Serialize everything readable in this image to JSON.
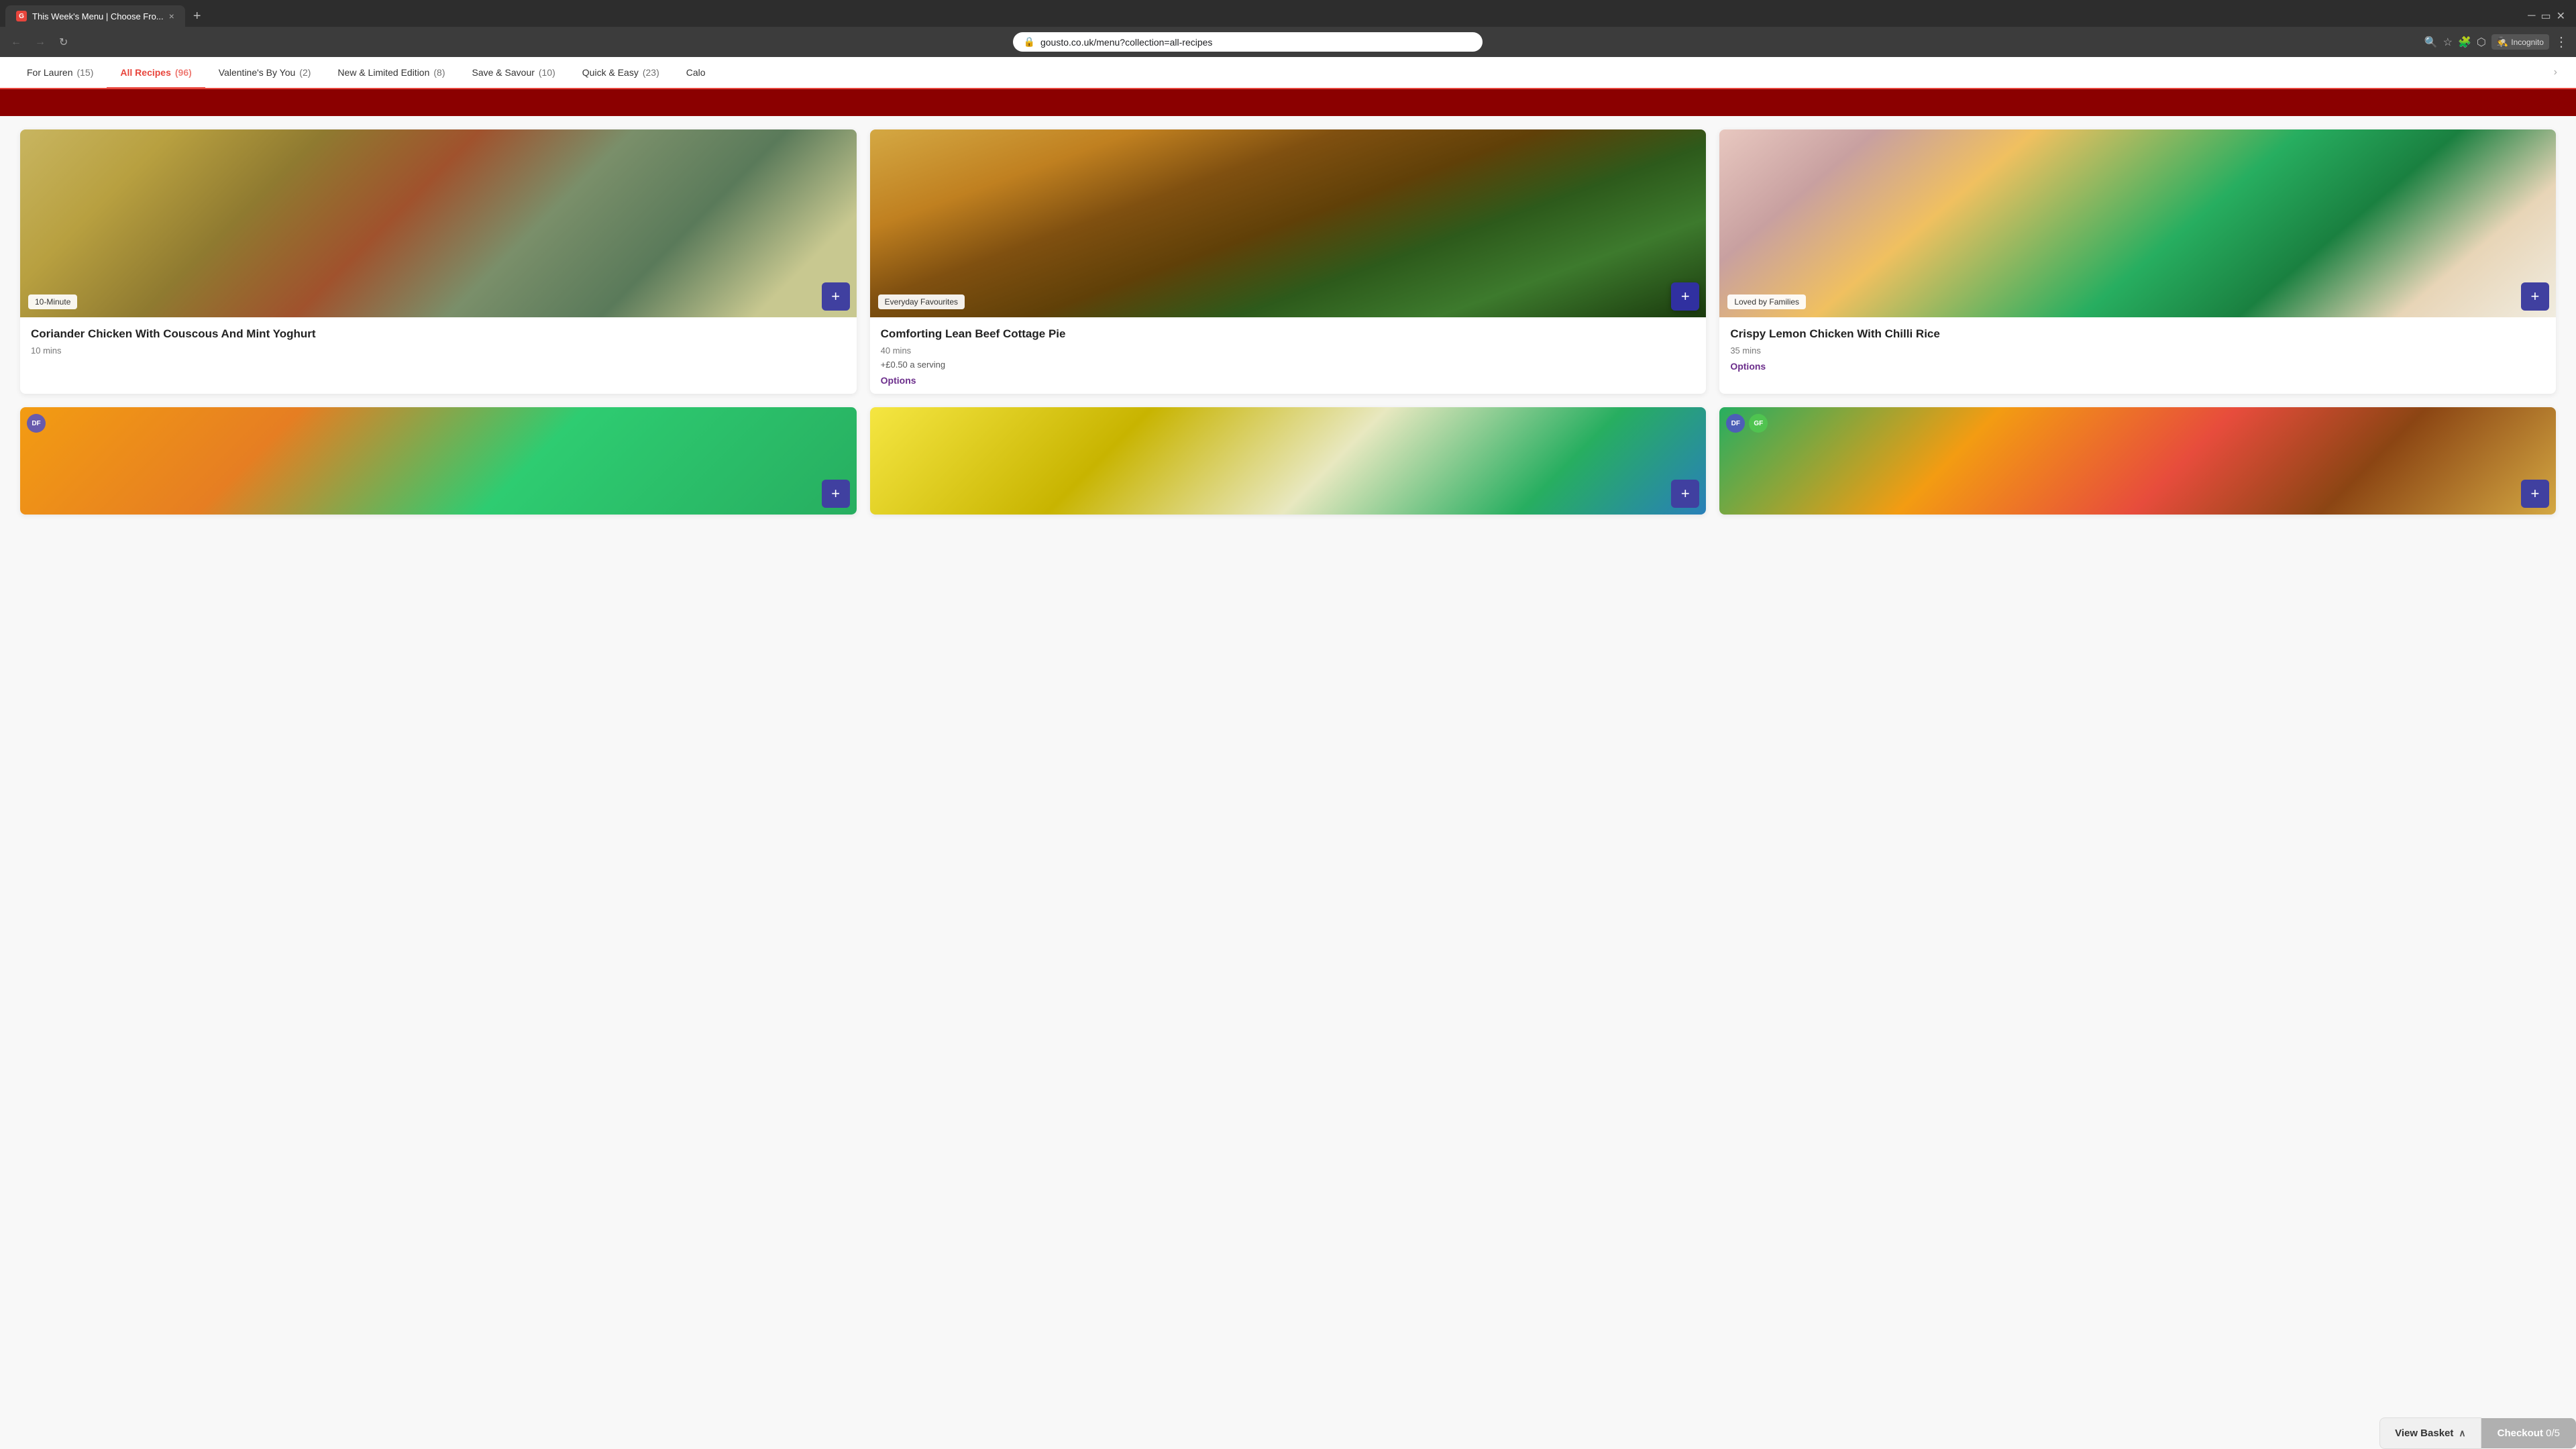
{
  "browser": {
    "tab_favicon": "G",
    "tab_title": "This Week's Menu | Choose Fro...",
    "tab_close": "×",
    "tab_new": "+",
    "url": "gousto.co.uk/menu?collection=all-recipes",
    "incognito_label": "Incognito",
    "nav_back": "←",
    "nav_forward": "→",
    "nav_refresh": "↻",
    "menu_dots": "⋮"
  },
  "nav": {
    "tabs": [
      {
        "id": "for-lauren",
        "label": "For Lauren",
        "count": "(15)"
      },
      {
        "id": "all-recipes",
        "label": "All Recipes",
        "count": "(96)",
        "active": true
      },
      {
        "id": "valentines",
        "label": "Valentine's By You",
        "count": "(2)"
      },
      {
        "id": "new-limited",
        "label": "New & Limited Edition",
        "count": "(8)"
      },
      {
        "id": "save-savour",
        "label": "Save & Savour",
        "count": "(10)"
      },
      {
        "id": "quick-easy",
        "label": "Quick & Easy",
        "count": "(23)"
      },
      {
        "id": "calo",
        "label": "Calo",
        "count": ""
      }
    ],
    "more_arrow": "›"
  },
  "recipes": [
    {
      "id": "card-1",
      "tag": "10-Minute",
      "title": "Coriander Chicken With Couscous And Mint Yoghurt",
      "time": "10 mins",
      "price": null,
      "options": null,
      "add_btn": "+",
      "badges": [],
      "img_class": "recipe-img-1"
    },
    {
      "id": "card-2",
      "tag": "Everyday Favourites",
      "title": "Comforting Lean Beef Cottage Pie",
      "time": "40 mins",
      "price": "+£0.50 a serving",
      "options": "Options",
      "add_btn": "+",
      "badges": [],
      "img_class": "recipe-img-2"
    },
    {
      "id": "card-3",
      "tag": "Loved by Families",
      "title": "Crispy Lemon Chicken With Chilli Rice",
      "time": "35 mins",
      "price": null,
      "options": "Options",
      "add_btn": "+",
      "badges": [],
      "img_class": "recipe-img-3"
    },
    {
      "id": "card-4",
      "tag": null,
      "title": "",
      "time": "",
      "price": null,
      "options": null,
      "add_btn": "+",
      "badges": [
        "DF"
      ],
      "img_class": "recipe-img-4"
    },
    {
      "id": "card-5",
      "tag": null,
      "title": "",
      "time": "",
      "price": null,
      "options": null,
      "add_btn": "+",
      "badges": [],
      "img_class": "recipe-img-5"
    },
    {
      "id": "card-6",
      "tag": null,
      "title": "",
      "time": "",
      "price": null,
      "options": null,
      "add_btn": "+",
      "badges": [
        "DF",
        "GF"
      ],
      "img_class": "recipe-img-6"
    }
  ],
  "bottom_bar": {
    "view_basket": "View Basket",
    "chevron": "∧",
    "checkout": "Checkout",
    "count": "0/5"
  },
  "colors": {
    "accent_red": "#e8453c",
    "dark_red": "#8b0000",
    "add_btn_bg": "#4040a0",
    "options_purple": "#6b2d8b",
    "checkout_gray": "#b0b0b0"
  }
}
